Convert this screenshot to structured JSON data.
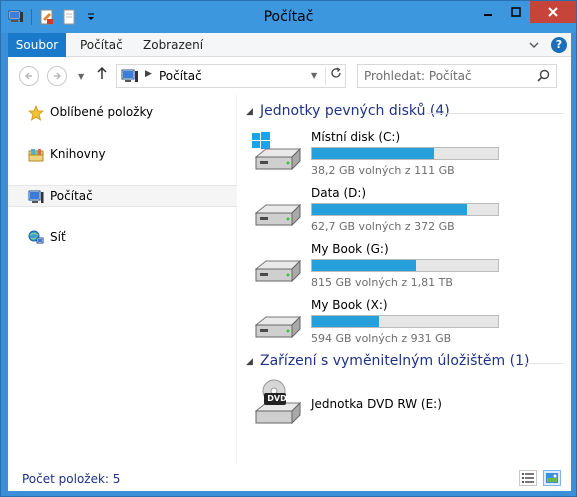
{
  "window": {
    "title": "Počítač"
  },
  "ribbon": {
    "tabs": [
      {
        "label": "Soubor"
      },
      {
        "label": "Počítač"
      },
      {
        "label": "Zobrazení"
      }
    ]
  },
  "address": {
    "current": "Počítač"
  },
  "search": {
    "placeholder": "Prohledat: Počítač"
  },
  "nav": {
    "items": [
      {
        "label": "Oblíbené položky",
        "icon": "star-icon"
      },
      {
        "label": "Knihovny",
        "icon": "libraries-icon"
      },
      {
        "label": "Počítač",
        "icon": "computer-icon",
        "selected": true
      },
      {
        "label": "Síť",
        "icon": "network-icon"
      }
    ]
  },
  "groups": [
    {
      "title": "Jednotky pevných disků (4)"
    },
    {
      "title": "Zařízení s vyměnitelným úložištěm (1)"
    }
  ],
  "drives": [
    {
      "name": "Místní disk (C:)",
      "free_text": "38,2 GB volných z 111 GB",
      "used_fraction": 0.656,
      "icon": "windows-drive-icon"
    },
    {
      "name": "Data (D:)",
      "free_text": "62,7 GB volných z 372 GB",
      "used_fraction": 0.831,
      "icon": "hard-drive-icon"
    },
    {
      "name": "My Book (G:)",
      "free_text": "815 GB volných z 1,81 TB",
      "used_fraction": 0.56,
      "icon": "hard-drive-icon"
    },
    {
      "name": "My Book (X:)",
      "free_text": "594 GB volných z 931 GB",
      "used_fraction": 0.362,
      "icon": "hard-drive-icon"
    }
  ],
  "removable": [
    {
      "name": "Jednotka DVD RW (E:)",
      "badge": "DVD",
      "icon": "dvd-drive-icon"
    }
  ],
  "status": {
    "text": "Počet položek: 5"
  },
  "colors": {
    "accent": "#26a0da",
    "title_bar": "#3c97de",
    "file_tab": "#1979ca",
    "group_text": "#1e3287",
    "close": "#c7443a"
  }
}
